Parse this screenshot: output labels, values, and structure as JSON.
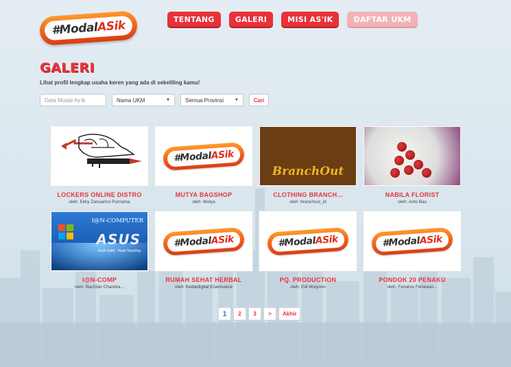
{
  "brand": {
    "logo_prefix": "#Modal",
    "logo_accent": "ASik"
  },
  "nav": [
    {
      "label": "TENTANG",
      "state": "default"
    },
    {
      "label": "GALERI",
      "state": "default"
    },
    {
      "label": "MISI AS'IK",
      "state": "default"
    },
    {
      "label": "DAFTAR UKM",
      "state": "muted"
    }
  ],
  "page": {
    "title": "GALERI",
    "subtitle": "Lihat profil lengkap usaha keren yang ada di sekeliling kamu!"
  },
  "filters": {
    "search_placeholder": "Data Modal As'ik",
    "category_value": "Nama UKM",
    "province_value": "Semua Provinsi",
    "submit_label": "Cari"
  },
  "gallery": [
    {
      "name": "LOCKERS ONLINE DISTRO",
      "owner": "oleh: Ekky Zanuarico Purnama",
      "image": "lockers-drawing"
    },
    {
      "name": "MUTYA BAGSHOP",
      "owner": "oleh: Mutya",
      "image": "modalasik-logo"
    },
    {
      "name": "CLOTHING BRANCH...",
      "owner": "oleh: branchout_id",
      "image": "branchout-logo",
      "image_text": "BranchOut"
    },
    {
      "name": "NABILA FLORIST",
      "owner": "oleh: Anto Bas",
      "image": "rose-bouquet"
    },
    {
      "name": "I@N-COMP",
      "owner": "oleh: Bachtiar Chandra...",
      "image": "asus-banner",
      "image_text": "I@N-COMPUTER",
      "image_brand": "ASUS",
      "image_slogan": "Rock Solid · Heart Touching"
    },
    {
      "name": "RUMAH SEHAT HERBAL",
      "owner": "oleh: Kedaidigital Enamsatoe",
      "image": "modalasik-logo"
    },
    {
      "name": "PQ. PRODUCTION",
      "owner": "oleh: Edi Mulyono",
      "image": "modalasik-logo"
    },
    {
      "name": "PONDOK 20 PENAKU",
      "owner": "oleh: Ferialna Ferlawan...",
      "image": "modalasik-logo"
    }
  ],
  "pagination": {
    "pages": [
      "1",
      "2",
      "3"
    ],
    "current": "1",
    "next_label": ">",
    "last_label": "Akhir"
  },
  "colors": {
    "accent": "#e8323a",
    "background": "#e4edf3",
    "logo_orange": "#f05a1a"
  }
}
